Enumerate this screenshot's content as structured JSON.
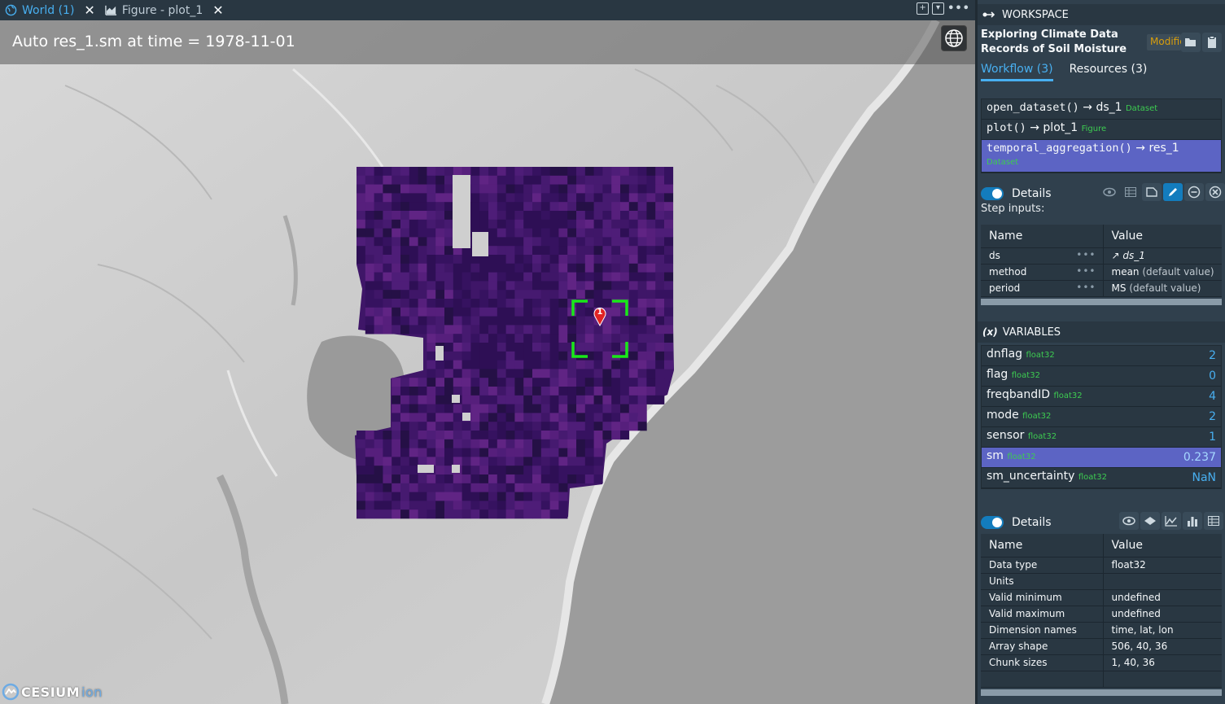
{
  "tabs": [
    {
      "label": "World (1)",
      "icon": "globe-icon",
      "active": true
    },
    {
      "label": "Figure - plot_1",
      "icon": "area-chart-icon",
      "active": false
    }
  ],
  "map": {
    "title": "Auto res_1.sm at time = 1978-11-01",
    "marker_label": "1",
    "logo_text": "CESIUM",
    "logo_suffix": "ion"
  },
  "workspace": {
    "header": "WORKSPACE",
    "title": "Exploring Climate Data Records of Soil Moisture",
    "modified_badge": "Modified",
    "tabs": [
      "Workflow (3)",
      "Resources (3)"
    ],
    "steps": [
      {
        "call": "open_dataset()",
        "result": "ds_1",
        "type": "Dataset"
      },
      {
        "call": "plot()",
        "result": "plot_1",
        "type": "Figure"
      },
      {
        "call": "temporal_aggregation()",
        "result": "res_1",
        "type": "Dataset",
        "selected": true
      }
    ],
    "details_label": "Details",
    "step_inputs_label": "Step inputs:",
    "inputs_table": {
      "headers": [
        "Name",
        "Value"
      ],
      "rows": [
        {
          "name": "ds",
          "value": "ds_1",
          "note": ""
        },
        {
          "name": "method",
          "value": "mean",
          "note": "(default value)"
        },
        {
          "name": "period",
          "value": "MS",
          "note": "(default value)"
        }
      ]
    }
  },
  "variables": {
    "header": "VARIABLES",
    "items": [
      {
        "name": "dnflag",
        "type": "float32",
        "value": "2"
      },
      {
        "name": "flag",
        "type": "float32",
        "value": "0"
      },
      {
        "name": "freqbandID",
        "type": "float32",
        "value": "4"
      },
      {
        "name": "mode",
        "type": "float32",
        "value": "2"
      },
      {
        "name": "sensor",
        "type": "float32",
        "value": "1"
      },
      {
        "name": "sm",
        "type": "float32",
        "value": "0.237",
        "selected": true
      },
      {
        "name": "sm_uncertainty",
        "type": "float32",
        "value": "NaN"
      }
    ],
    "details_label": "Details",
    "details_table": {
      "headers": [
        "Name",
        "Value"
      ],
      "rows": [
        {
          "name": "Data type",
          "value": "float32"
        },
        {
          "name": "Units",
          "value": ""
        },
        {
          "name": "Valid minimum",
          "value": "undefined"
        },
        {
          "name": "Valid maximum",
          "value": "undefined"
        },
        {
          "name": "Dimension names",
          "value": "time, lat, lon"
        },
        {
          "name": "Array shape",
          "value": "506, 40, 36"
        },
        {
          "name": "Chunk sizes",
          "value": "1, 40, 36"
        }
      ]
    }
  },
  "colors": {
    "accent": "#48aff0",
    "selected_row": "#5c64c4",
    "type_tag": "#3dcc51",
    "modified": "#d99e0b",
    "target_box": "#19e819",
    "marker": "#e02424"
  }
}
